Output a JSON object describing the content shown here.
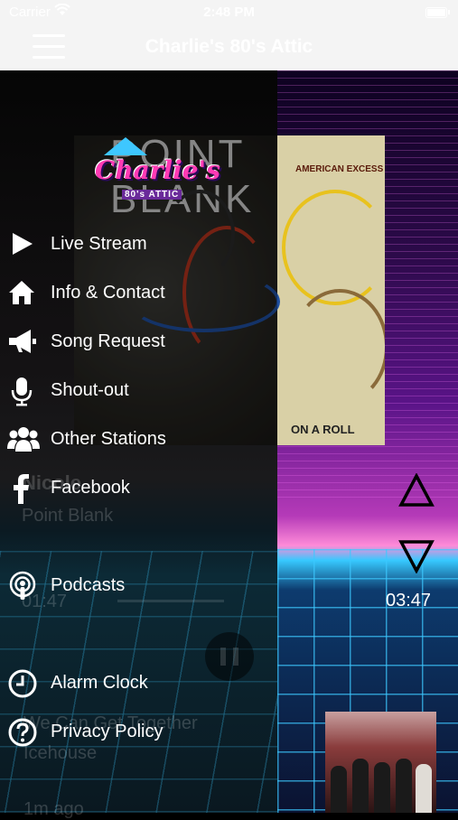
{
  "status_bar": {
    "carrier": "Carrier",
    "time": "2:48 PM"
  },
  "navbar": {
    "title": "Charlie's 80's Attic"
  },
  "album": {
    "band": "POINT BLANK",
    "subtitle": "AMERICAN EXCESS",
    "sticker": "ON A ROLL"
  },
  "logo": {
    "name": "Charlie's",
    "tagline": "80's ATTIC"
  },
  "menu": {
    "items": [
      {
        "label": "Live Stream",
        "icon": "play-icon"
      },
      {
        "label": "Info & Contact",
        "icon": "home-icon"
      },
      {
        "label": "Song Request",
        "icon": "megaphone-icon"
      },
      {
        "label": "Shout-out",
        "icon": "microphone-icon"
      },
      {
        "label": "Other Stations",
        "icon": "users-icon"
      },
      {
        "label": "Facebook",
        "icon": "facebook-icon"
      },
      {
        "label": "Podcasts",
        "icon": "podcast-icon"
      },
      {
        "label": "Alarm Clock",
        "icon": "clock-icon"
      },
      {
        "label": "Privacy Policy",
        "icon": "help-icon"
      }
    ]
  },
  "player": {
    "now_title": "Nicole",
    "now_artist": "Point Blank",
    "elapsed": "01:47",
    "duration": "03:47",
    "next_title": "We Can Get Together",
    "next_artist": "Icehouse",
    "next_time": "1m ago"
  },
  "colors": {
    "accent_pink": "#ff3ab4",
    "accent_cyan": "#37c9ff",
    "bar": "#f4f4f4"
  }
}
